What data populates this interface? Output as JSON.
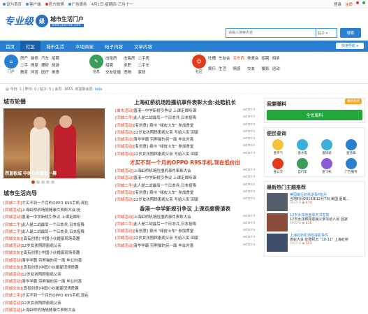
{
  "topbar": {
    "left": [
      "设为首页",
      "客户端",
      "官方微博",
      "广告服务",
      "4月1日 星期四 三月十一"
    ],
    "right": [
      "登录",
      "注册"
    ]
  },
  "logo": {
    "text1": "专业级",
    "circle": "级",
    "site": "城市生活门户",
    "url": "www.yoursite.com"
  },
  "search": {
    "placeholder": "请输入搜索内容",
    "select": "帖子",
    "button": "搜索"
  },
  "nav": {
    "items": [
      "首页",
      "社区",
      "城市生活",
      "本地商家",
      "帖子内容",
      "文章内容"
    ],
    "active": 1,
    "fast": "快速导航"
  },
  "categories": [
    {
      "label": "门户",
      "color": "#2b7fd0",
      "links": [
        "房产",
        "装修",
        "汽车",
        "招聘",
        "二手",
        "商家",
        "理财",
        "旅游",
        "教育",
        "问答",
        "医疗",
        "美食"
      ]
    },
    {
      "label": "信息",
      "color": "#3a9d5a",
      "links": [
        "出租房",
        "出售房",
        "二手房",
        "招聘",
        "求职",
        "二手车",
        "交友征婚",
        "宠物",
        "家政"
      ]
    },
    {
      "label": "社区",
      "color": "#e03c1a",
      "links": [
        "吐槽",
        "车友会",
        "美食会",
        "招聘",
        "相亲",
        "娱乐",
        "生活",
        "情感",
        "交友",
        "摄影",
        "运动"
      ]
    }
  ],
  "red_links": [
    "买东西"
  ],
  "crumb": {
    "prefix": "今日:",
    "today": "1",
    "yesterday": "昨日: 0",
    "posts": "帖子: 5",
    "members": "会员: 1615",
    "newest": "欢迎新会员:",
    "name": "lede"
  },
  "left": {
    "carousel_title": "城市轮播",
    "caption": "西直板城 中国小伙婚宴一幕",
    "guide_title": "城市生活向导",
    "guide_rows": [
      {
        "tag": "[同城二手]",
        "text": "才买不到一个月的OPPO R9S手机,现在"
      },
      {
        "tag": "[同城活动]",
        "text": "上海虹桥机场随随事件表彰大会:处"
      },
      {
        "tag": "[同城活动]",
        "text": "香港一中学新规引争议 上课走廊听"
      },
      {
        "tag": "[同城二手]",
        "text": "此人是二战最后一个日本兵,日本投降"
      },
      {
        "tag": "[同城二手]",
        "text": "此人是二战最后一个日本兵,日本投降"
      },
      {
        "tag": "[同城交友]",
        "text": "[真有创意] 中国小伙婚宴现场奇趣"
      },
      {
        "tag": "[同城活动]",
        "text": "12岁女孩照顾患病父亲"
      },
      {
        "tag": "[同城交友]",
        "text": "[真有创意] 中国小伙婚宴现场奇趣"
      },
      {
        "tag": "[同城活动]",
        "text": "清华学霸 穷熊猫的另一面 毕业时喜"
      },
      {
        "tag": "[同城交友]",
        "text": "[真有创意]中国小伙婚宴现场奇趣"
      },
      {
        "tag": "[同城活动]",
        "text": "12岁女孩照顾患病父亲"
      },
      {
        "tag": "[同城活动]",
        "text": "清华学霸 穷熊猫的另一面 毕业时喜"
      },
      {
        "tag": "[同城交友]",
        "text": "[真有创意]中国小伙婚宴现场奇趣"
      },
      {
        "tag": "[同城二手]",
        "text": "才买不到一个月的OPPO R9S手机,现在"
      },
      {
        "tag": "[同城活动]",
        "text": "12岁女孩照顾患病父亲"
      },
      {
        "tag": "[同城活动]",
        "text": "上海虹桥机场随随事件表彰大会"
      }
    ]
  },
  "middle": {
    "headline1": "上海虹桥机场险撞机事件表彰大会:处赔机长",
    "rows1": [
      {
        "tag": "[城市活动]",
        "text": "香港一中学新规引争议 上课走廊听课",
        "au": "admin"
      },
      {
        "tag": "[同城二手]",
        "text": "此人是二战最后一个日本兵,日本投降",
        "au": "admin"
      },
      {
        "tag": "[同城活动]",
        "text": "[有创意] 泉州 \"绿皮火车\" 参加食堂",
        "au": "admin"
      },
      {
        "tag": "[同城活动]",
        "text": "12岁女孩照顾患病父亲 写给人民 回家",
        "au": "admin"
      },
      {
        "tag": "[同城活动]",
        "text": "清华学霸 穷熊猫的另一面 毕业时喜",
        "au": "admin"
      },
      {
        "tag": "[同城活动]",
        "text": "[有创意] 泉州 \"绿皮火车\" 参加食堂",
        "au": "admin"
      },
      {
        "tag": "[同城活动]",
        "text": "12岁女孩照顾患病父亲 写给人民 回家",
        "au": "admin"
      }
    ],
    "headline2": "才买不到一个月的OPPO R9S手机,现在低价出",
    "rows2": [
      {
        "tag": "[同城活动]",
        "text": "上海虹桥机场险撞机事件表彰大会",
        "au": "admin"
      },
      {
        "tag": "[同城活动]",
        "text": "香港一中学新规引争议 上课走廊听课",
        "au": "admin"
      },
      {
        "tag": "[同城二手]",
        "text": "此人是二战最后一个日本兵,日本投降",
        "au": "admin"
      },
      {
        "tag": "[同城活动]",
        "text": "[有创意] 泉州 \"绿皮火车\" 参加食堂",
        "au": "admin"
      },
      {
        "tag": "[同城活动]",
        "text": "12岁女孩照顾患病父亲 写给人民 回家",
        "au": "admin"
      }
    ],
    "headline3": "香港一中学新规引争议 上课走廊需请表",
    "rows3": [
      {
        "tag": "[同城活动]",
        "text": "上海虹桥机场险撞机事件表彰大会",
        "au": "admin"
      },
      {
        "tag": "[同城二手]",
        "text": "此人是二战最后一个日本兵,日本投降",
        "au": "admin"
      },
      {
        "tag": "[同城活动]",
        "text": "[有创意] 泉州 \"绿皮火车\" 参加食堂",
        "au": "admin"
      },
      {
        "tag": "[同城活动]",
        "text": "12岁女孩照顾患病父亲 写给人民 回家",
        "au": "admin"
      },
      {
        "tag": "[同城活动]",
        "text": "清华学霸 穷熊猫的另一面 毕业时喜",
        "au": "admin"
      }
    ]
  },
  "right": {
    "expose_title": "我要曝料",
    "badge": "曝料有奖",
    "expose_btn": "全民爆料",
    "convenience_title": "便民查询",
    "convenience": [
      {
        "label": "查天气",
        "color": "#f5c23a"
      },
      {
        "label": "查水电",
        "color": "#3ab0d8"
      },
      {
        "label": "查快递",
        "color": "#3ab0d8"
      },
      {
        "label": "查违章",
        "color": "#2b7fd0"
      },
      {
        "label": "查公交",
        "color": "#e03c1a"
      },
      {
        "label": "自行车",
        "color": "#3a9d5a"
      },
      {
        "label": "查飞机",
        "color": "#8b5bd6"
      },
      {
        "label": "广告服务",
        "color": "#2b7fd0"
      }
    ],
    "hot_title": "最新热门主题推荐",
    "hot": [
      {
        "title": "美国审行的扬退事件5月",
        "sub": "当地时间2016年12月7日,美国 夏威...",
        "date": "2017-4",
        "num": "474",
        "c": "#555e6b"
      },
      {
        "title": "12岁女孩地盘事务书发等",
        "sub": "12岁女孩照顾患病父亲写给人民 回家",
        "date": "2017-4",
        "num": "416",
        "c": "#8a4b3a"
      },
      {
        "title": "上海虹桥机场险撞机事件",
        "sub": "表彰大会:处赔机长 \"10-11\" 上海虹桥",
        "date": "2017-4",
        "num": "523",
        "c": "#3e4e6b"
      }
    ]
  }
}
